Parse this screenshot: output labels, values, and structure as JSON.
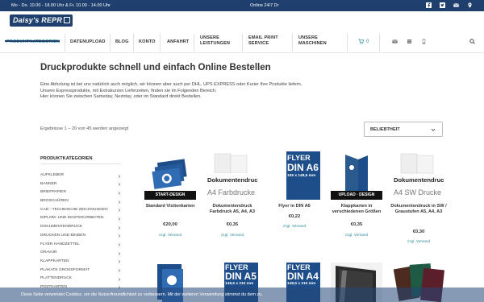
{
  "topbar": {
    "hours": "Mo - Do. 10.00 - 18.00 Uhr & Fr. 10.00 - 14.00 Uhr",
    "online": "Online 24/7 Dr"
  },
  "logo": {
    "text": "Daisy's REPR"
  },
  "nav": [
    {
      "label": "PRODUKTKATEGORIEN"
    },
    {
      "label": "DATENUPLOAD"
    },
    {
      "label": "BLOG"
    },
    {
      "label": "KONTO"
    },
    {
      "label": "ANFAHRT"
    },
    {
      "label_line1": "UNSERE",
      "label_line2": "LEISTUNGEN"
    },
    {
      "label_line1": "EMAIL PRINT",
      "label_line2": "SERVICE"
    },
    {
      "label_line1": "UNSERE",
      "label_line2": "MASCHINEN"
    }
  ],
  "cart": {
    "count": "0"
  },
  "page": {
    "title": "Druckprodukte schnell und einfach Online Bestellen",
    "intro": [
      "Eine Abholung ist bei uns natürlich auch möglich, wir können aber auch per DHL, UPS EXPRESS oder Kurier Ihre Produkte liefern.",
      "Unsere Expressprodukte, mit Extrakurzen Lieferzeiten, finden sie im Folgenden Bereich.",
      "Hier können Sie zwischen Sameday, Nextday, oder im Standard direkt Bestellen."
    ],
    "results": "Ergebnisse 1 – 20 von 45 werden angezeigt",
    "sort_label": "BELIEBTHEIT"
  },
  "sidebar": {
    "title": "PRODUKTKATEGORIEN",
    "items": [
      "AUFKLEBER",
      "BANNER",
      "BRIEFPAPIER",
      "BROSCHÜREN",
      "CAD - TECHNISCHE ZEICHNUNGEN",
      "DIPLOM- UND MASTERARBEITEN",
      "DOKUMENTENDRUCK",
      "DRUCKEN UND BINDEN",
      "FLYER HANDZETTEL",
      "GRAVUR",
      "KLAPPKARTEN",
      "PLAKATE GROSSFORMAT",
      "PLATTENDRUCK",
      "POSTKARTEN"
    ]
  },
  "products": [
    {
      "name": "Standard Visitenkarten",
      "price": "€20,00",
      "shipping": "zzgl. Versand",
      "badge": "START-DESIGN"
    },
    {
      "name": "Dokumentendruck Farbdruck A5, A4, A3",
      "price": "€0,35",
      "shipping": "zzgl. Versand",
      "badge": "",
      "img_line1": "Dokumentendruck",
      "img_line2": "A4 Farbdrucke"
    },
    {
      "name": "Flyer in DIN A6",
      "price": "€0,22",
      "shipping": "zzgl. Versand",
      "badge": "",
      "img_line1": "FLYER",
      "img_line2": "DIN A6",
      "img_line3": "105 x 148,5 mm"
    },
    {
      "name": "Klappkarten in verschiedenen Größen",
      "price": "€0,35",
      "shipping": "zzgl. Versand",
      "badge": "UPLOAD · DESIGN"
    },
    {
      "name": "Dokumentendruck in SW / Graustufen A5, A4, A3",
      "price": "€0,30",
      "shipping": "zzgl. Versand",
      "badge": "",
      "img_line1": "Dokumentendruck",
      "img_line2": "A4 SW Drucke"
    },
    {
      "img_line1": "FLYER",
      "img_line2": "DIN A5",
      "img_line3": "148,5 x 210 mm"
    },
    {
      "img_line1": "FLYER",
      "img_line2": "DIN A4",
      "img_line3": "148,5 x 210 mm"
    }
  ],
  "cookie": {
    "text": "Diese Seite verwendet Cookies, um die Nutzerfreundlichkeit zu verbessern. Mit der weiteren Verwendung stimmst du dem zu."
  },
  "colors": {
    "brand": "#1f3f6e",
    "accent": "#2c8a9a"
  }
}
